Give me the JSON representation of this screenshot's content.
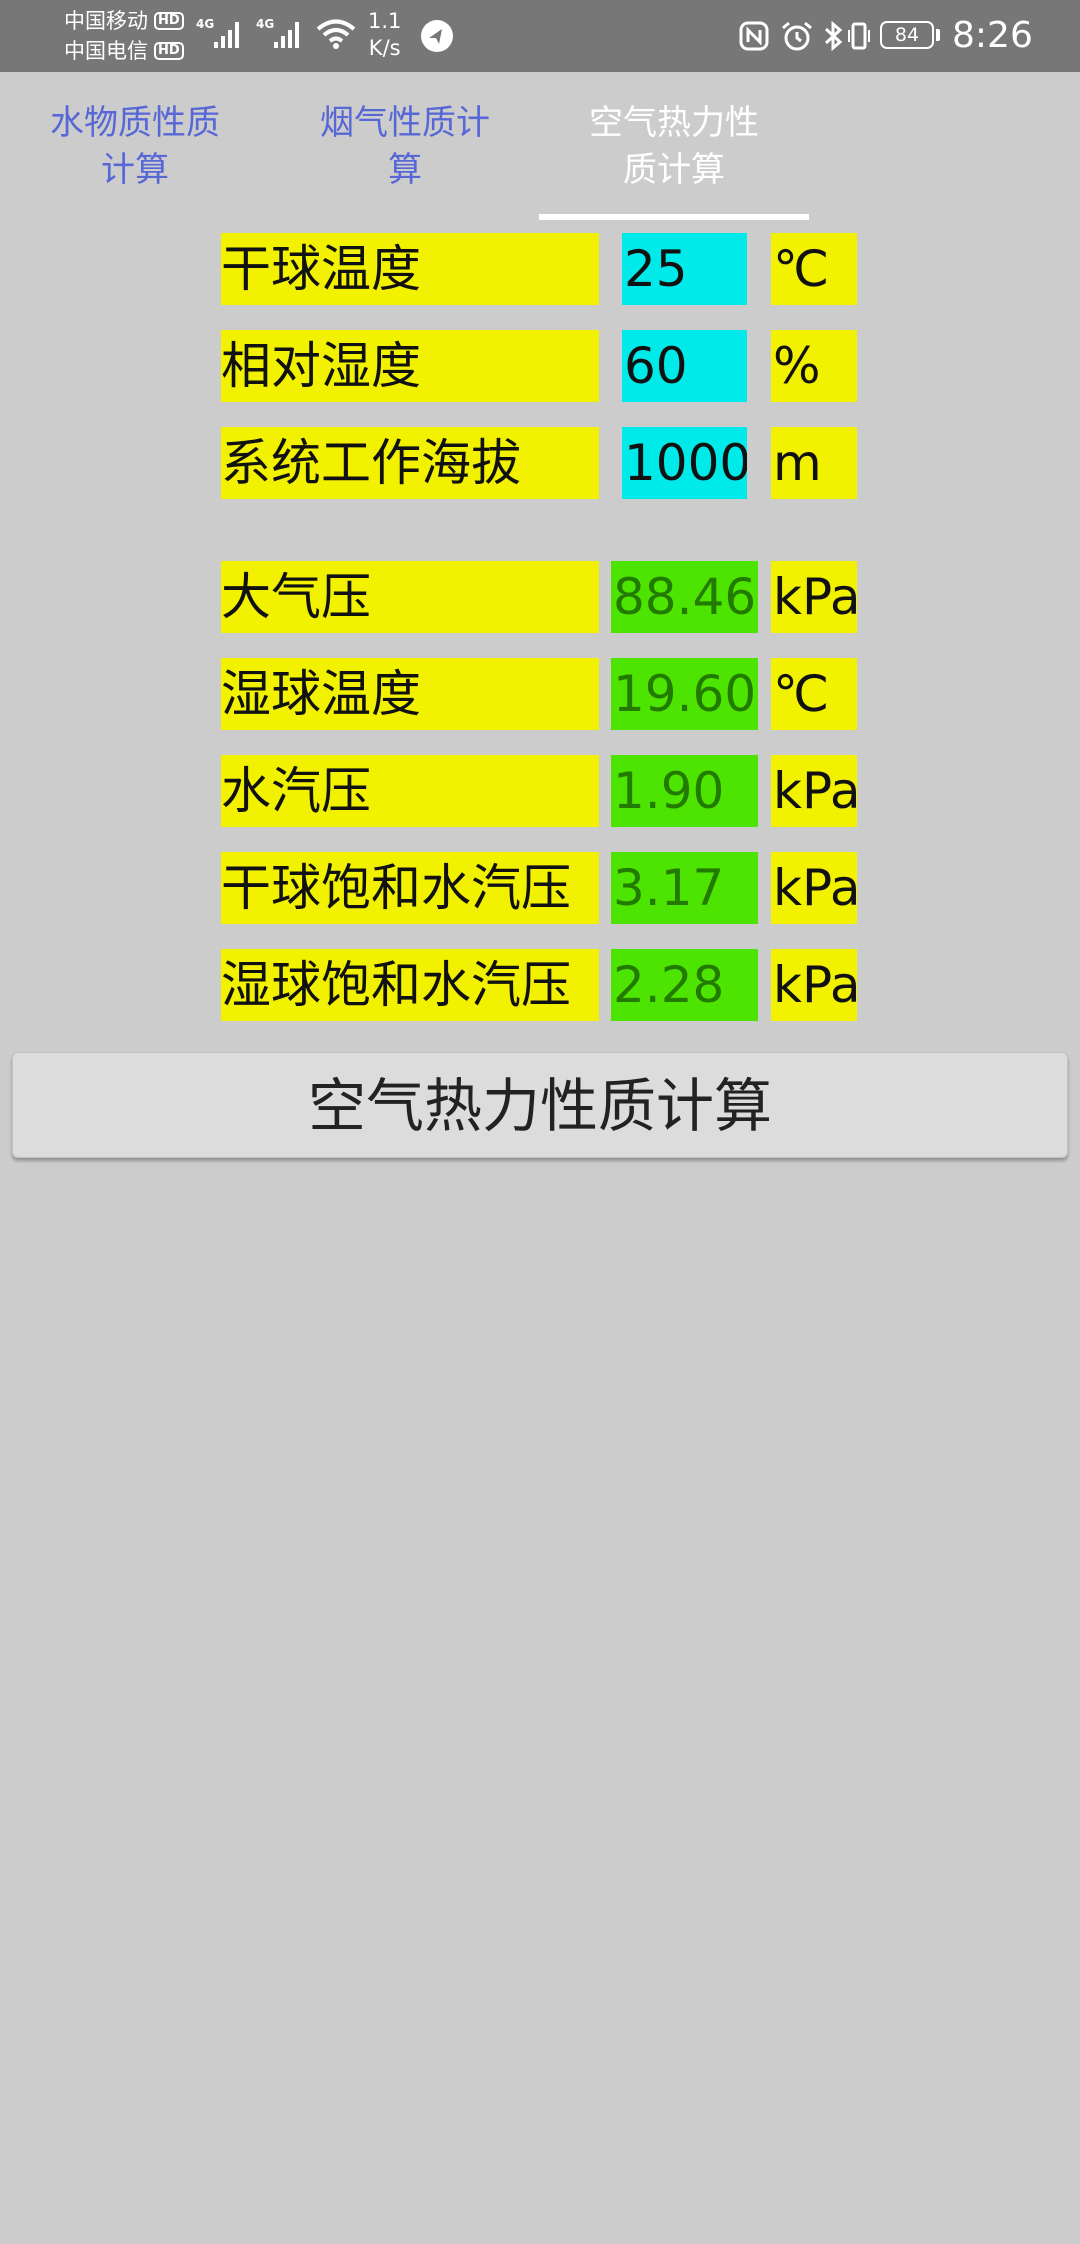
{
  "status_bar": {
    "carrier1": "中国移动",
    "carrier2": "中国电信",
    "hd": "HD",
    "network_type": "4G",
    "speed_value": "1.1",
    "speed_unit": "K/s",
    "battery": "84",
    "time": "8:26"
  },
  "tabs": [
    {
      "line1": "水物质性质",
      "line2": "计算",
      "active": false
    },
    {
      "line1": "烟气性质计",
      "line2": "算",
      "active": false
    },
    {
      "line1": "空气热力性",
      "line2": "质计算",
      "active": true
    }
  ],
  "inputs": [
    {
      "label": "干球温度",
      "value": "25",
      "unit": "℃"
    },
    {
      "label": "相对湿度",
      "value": "60",
      "unit": "%"
    },
    {
      "label": "系统工作海拔",
      "value": "1000",
      "unit": "m"
    }
  ],
  "outputs": [
    {
      "label": "大气压",
      "value": "88.46",
      "unit": "kPa"
    },
    {
      "label": "湿球温度",
      "value": "19.60",
      "unit": "℃"
    },
    {
      "label": "水汽压",
      "value": "1.90",
      "unit": "kPa"
    },
    {
      "label": "干球饱和水汽压",
      "value": "3.17",
      "unit": "kPa"
    },
    {
      "label": "湿球饱和水汽压",
      "value": "2.28",
      "unit": "kPa"
    }
  ],
  "button": {
    "label": "空气热力性质计算"
  },
  "colors": {
    "label_bg": "#f2f200",
    "input_bg": "#00eaea",
    "output_bg": "#4ce400",
    "output_text": "#237a00",
    "tab_inactive": "#5767d6",
    "tab_active": "#ffffff",
    "background": "#cccccc"
  }
}
